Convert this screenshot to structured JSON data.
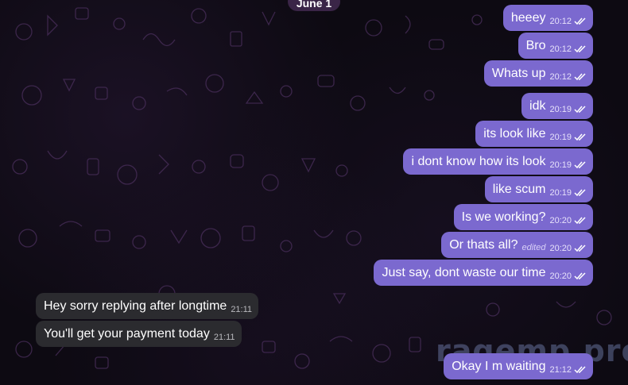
{
  "date_label": "June 1",
  "watermark": "ragemp.pro",
  "messages": [
    {
      "text": "heeey",
      "time": "20:12",
      "direction": "out",
      "status": "read"
    },
    {
      "text": "Bro",
      "time": "20:12",
      "direction": "out",
      "status": "read"
    },
    {
      "text": "Whats up",
      "time": "20:12",
      "direction": "out",
      "status": "read"
    },
    {
      "text": "idk",
      "time": "20:19",
      "direction": "out",
      "status": "read"
    },
    {
      "text": "its look like",
      "time": "20:19",
      "direction": "out",
      "status": "read"
    },
    {
      "text": "i dont know how its look",
      "time": "20:19",
      "direction": "out",
      "status": "read"
    },
    {
      "text": "like scum",
      "time": "20:19",
      "direction": "out",
      "status": "read"
    },
    {
      "text": "Is we working?",
      "time": "20:20",
      "direction": "out",
      "status": "read"
    },
    {
      "text": "Or thats all?",
      "edited": "edited",
      "time": "20:20",
      "direction": "out",
      "status": "read"
    },
    {
      "text": "Just say, dont waste our time",
      "time": "20:20",
      "direction": "out",
      "status": "read"
    },
    {
      "text": "Hey sorry replying after longtime",
      "time": "21:11",
      "direction": "in"
    },
    {
      "text": "You'll get your payment today",
      "time": "21:11",
      "direction": "in"
    },
    {
      "text": "Okay I m waiting",
      "time": "21:12",
      "direction": "out",
      "status": "read"
    }
  ],
  "colors": {
    "outgoing_bubble": "#7b69cf",
    "incoming_bubble": "#2b2b2f",
    "background": "#0d0a12"
  },
  "icons": {
    "read_status": "double-check-icon"
  }
}
